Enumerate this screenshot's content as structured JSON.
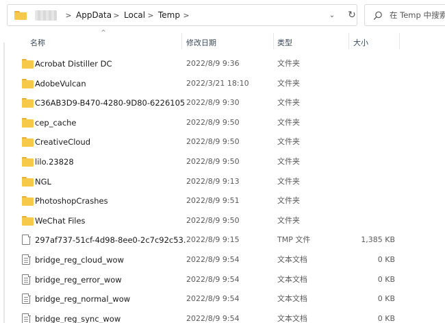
{
  "address": {
    "breadcrumbs": [
      "AppData",
      "Local",
      "Temp"
    ],
    "separator": ">",
    "dropdown_icon": "chevron-down-icon",
    "refresh_icon": "refresh-icon"
  },
  "search": {
    "placeholder": "在 Temp 中搜索",
    "icon": "search-icon"
  },
  "columns": {
    "name": "名称",
    "date": "修改日期",
    "type": "类型",
    "size": "大小",
    "sort_indicator": "^"
  },
  "files": [
    {
      "name": "Acrobat Distiller DC",
      "date": "2022/8/9 9:36",
      "type": "文件夹",
      "size": "",
      "icon": "folder-icon"
    },
    {
      "name": "AdobeVulcan",
      "date": "2022/3/21 18:10",
      "type": "文件夹",
      "size": "",
      "icon": "folder-icon"
    },
    {
      "name": "C36AB3D9-B470-4280-9D80-6226105...",
      "date": "2022/8/9 9:30",
      "type": "文件夹",
      "size": "",
      "icon": "folder-icon"
    },
    {
      "name": "cep_cache",
      "date": "2022/8/9 9:50",
      "type": "文件夹",
      "size": "",
      "icon": "folder-icon"
    },
    {
      "name": "CreativeCloud",
      "date": "2022/8/9 9:50",
      "type": "文件夹",
      "size": "",
      "icon": "folder-icon"
    },
    {
      "name": "lilo.23828",
      "date": "2022/8/9 9:50",
      "type": "文件夹",
      "size": "",
      "icon": "folder-icon"
    },
    {
      "name": "NGL",
      "date": "2022/8/9 9:13",
      "type": "文件夹",
      "size": "",
      "icon": "folder-icon"
    },
    {
      "name": "PhotoshopCrashes",
      "date": "2022/8/9 9:51",
      "type": "文件夹",
      "size": "",
      "icon": "folder-icon"
    },
    {
      "name": "WeChat Files",
      "date": "2022/8/9 9:50",
      "type": "文件夹",
      "size": "",
      "icon": "folder-icon"
    },
    {
      "name": "297af737-51cf-4d98-8ee0-2c7c92c53...",
      "date": "2022/8/9 9:15",
      "type": "TMP 文件",
      "size": "1,385 KB",
      "icon": "file-icon"
    },
    {
      "name": "bridge_reg_cloud_wow",
      "date": "2022/8/9 9:54",
      "type": "文本文档",
      "size": "0 KB",
      "icon": "text-file-icon"
    },
    {
      "name": "bridge_reg_error_wow",
      "date": "2022/8/9 9:54",
      "type": "文本文档",
      "size": "0 KB",
      "icon": "text-file-icon"
    },
    {
      "name": "bridge_reg_normal_wow",
      "date": "2022/8/9 9:54",
      "type": "文本文档",
      "size": "0 KB",
      "icon": "text-file-icon"
    },
    {
      "name": "bridge_reg_sync_wow",
      "date": "2022/8/9 9:54",
      "type": "文本文档",
      "size": "0 KB",
      "icon": "text-file-icon"
    }
  ],
  "colors": {
    "folder": "#f7c948",
    "folder_tab": "#e8ad33",
    "header_text": "#3b4a5a",
    "border": "#d9d9d9"
  }
}
